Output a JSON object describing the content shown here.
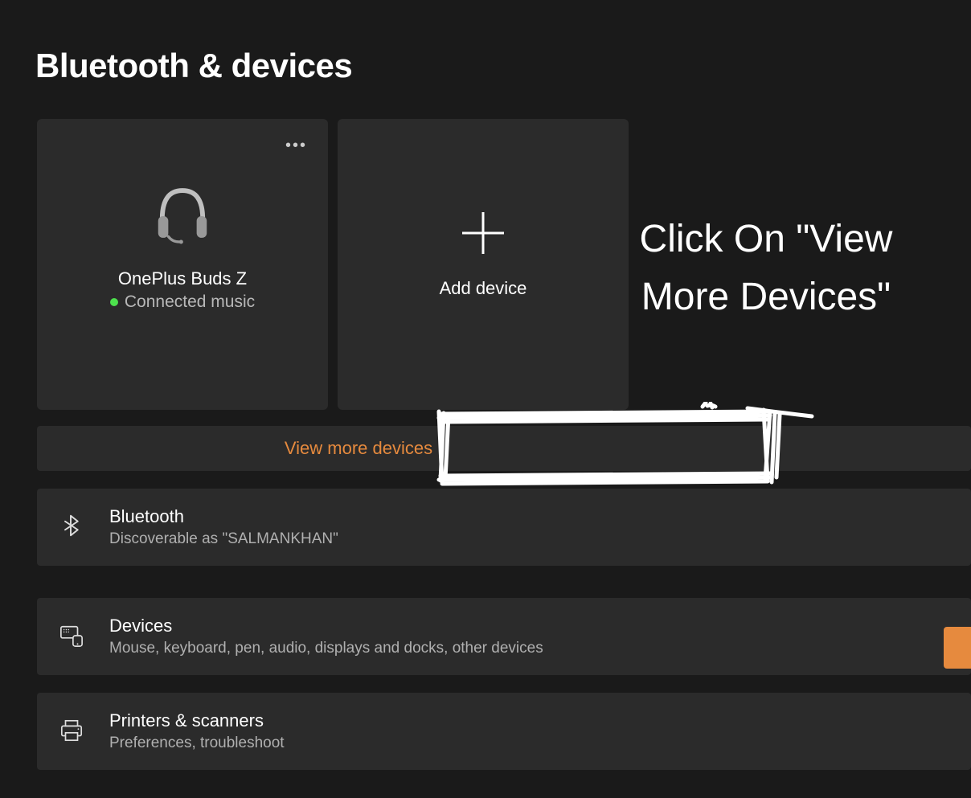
{
  "page": {
    "title": "Bluetooth & devices"
  },
  "device_card": {
    "name": "OnePlus Buds Z",
    "status": "Connected music",
    "more_label": "•••"
  },
  "add_card": {
    "label": "Add device"
  },
  "view_more": {
    "label": "View more devices"
  },
  "annotation": {
    "text": "Click On \"View More Devices\""
  },
  "rows": {
    "bluetooth": {
      "title": "Bluetooth",
      "subtitle": "Discoverable as \"SALMANKHAN\""
    },
    "devices": {
      "title": "Devices",
      "subtitle": "Mouse, keyboard, pen, audio, displays and docks, other devices"
    },
    "printers": {
      "title": "Printers & scanners",
      "subtitle": "Preferences, troubleshoot"
    }
  },
  "colors": {
    "accent": "#e68a3e",
    "status_green": "#4de24d"
  }
}
